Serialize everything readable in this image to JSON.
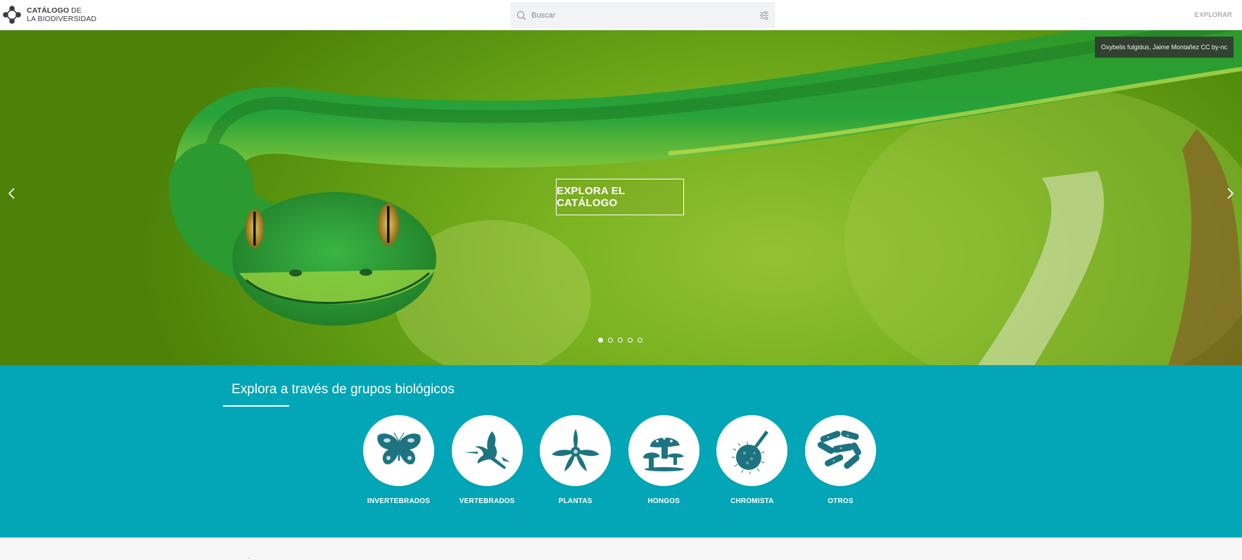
{
  "header": {
    "logo_line1_bold": "CATÁLOGO",
    "logo_line1_rest": " DE",
    "logo_line2": "LA BIODIVERSIDAD",
    "search_placeholder": "Buscar",
    "nav_explore": "EXPLORAR"
  },
  "hero": {
    "photo_credit": "Oxybelis fulgidus, Jaime Montañez CC by-nc",
    "cta_label": "EXPLORA EL CATÁLOGO",
    "slide_count": 5,
    "active_slide": 1
  },
  "groups_section": {
    "title": "Explora a través de grupos biológicos",
    "items": [
      {
        "label": "INVERTEBRADOS",
        "icon": "butterfly-icon"
      },
      {
        "label": "VERTEBRADOS",
        "icon": "hummingbird-icon"
      },
      {
        "label": "PLANTAS",
        "icon": "orchid-icon"
      },
      {
        "label": "HONGOS",
        "icon": "mushroom-icon"
      },
      {
        "label": "CHROMISTA",
        "icon": "chromista-icon"
      },
      {
        "label": "OTROS",
        "icon": "bacteria-icon"
      }
    ]
  },
  "bottom": {
    "mark": "´"
  },
  "colors": {
    "brand_teal": "#02a6b6",
    "icon_teal": "#1d7480",
    "credit_bg": "#323232"
  }
}
